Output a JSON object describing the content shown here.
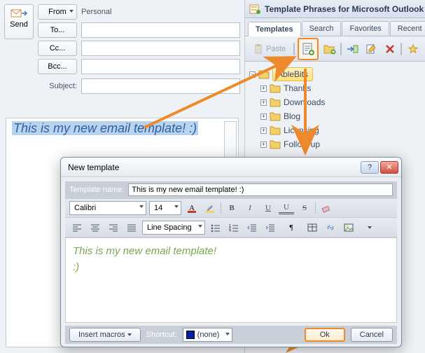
{
  "compose": {
    "send_label": "Send",
    "from_label": "From",
    "to_label": "To...",
    "cc_label": "Cc...",
    "bcc_label": "Bcc...",
    "account_label": "Personal",
    "subject_label": "Subject:",
    "body_text": "This is my new email template! :)"
  },
  "panel": {
    "title": "Template Phrases for Microsoft Outlook",
    "tabs": [
      "Templates",
      "Search",
      "Favorites",
      "Recent"
    ],
    "active_tab": "Templates",
    "paste_label": "Paste",
    "tree": {
      "root": "AbleBits",
      "children": [
        "Thanks",
        "Downloads",
        "Blog",
        "Licensing",
        "Follow-up"
      ]
    }
  },
  "dialog": {
    "title": "New template",
    "name_label": "Template name:",
    "name_value": "This is my new email template! :)",
    "font_name": "Calibri",
    "font_size": "14",
    "line_spacing_label": "Line Spacing",
    "editor_text": "This is my new email template!\n:)",
    "insert_macros_label": "Insert macros",
    "shortcut_label": "Shortcut:",
    "shortcut_value": "(none)",
    "ok_label": "Ok",
    "cancel_label": "Cancel"
  }
}
